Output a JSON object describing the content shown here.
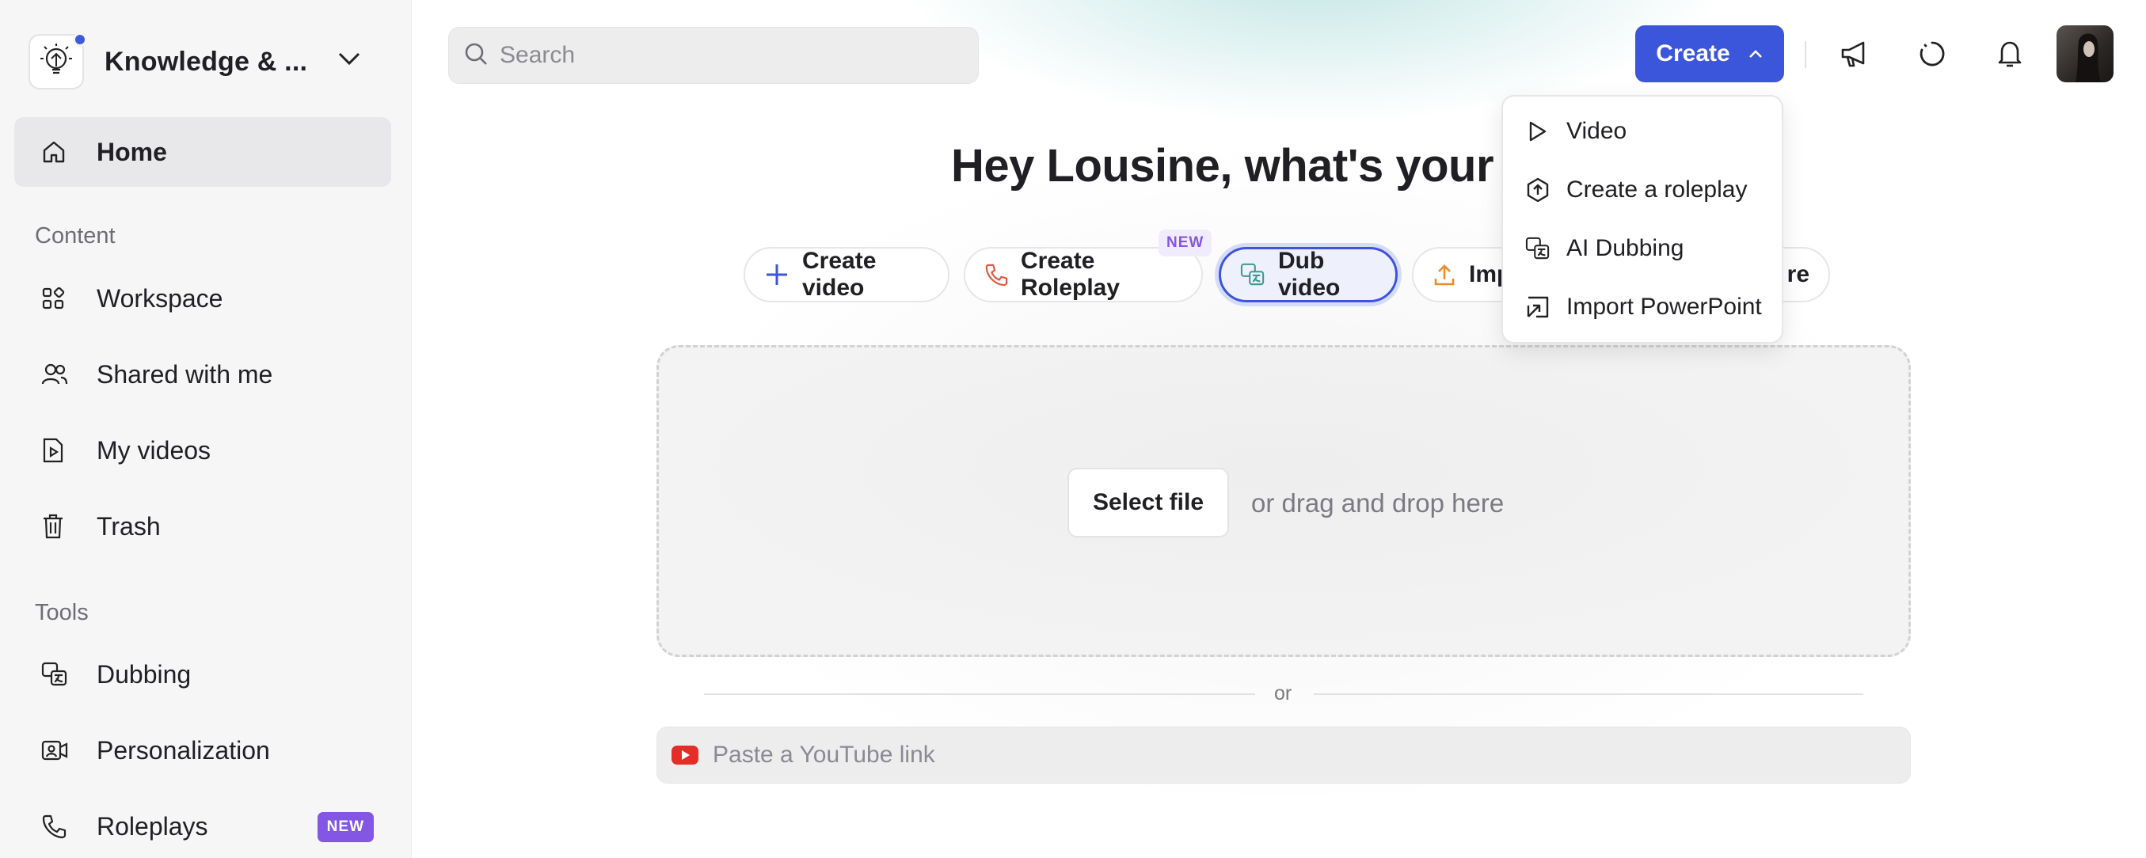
{
  "sidebar": {
    "workspace_name": "Knowledge & ...",
    "home_label": "Home",
    "content_section": "Content",
    "tools_section": "Tools",
    "content_items": [
      {
        "label": "Workspace",
        "icon": "grid-icon"
      },
      {
        "label": "Shared with me",
        "icon": "users-icon"
      },
      {
        "label": "My videos",
        "icon": "video-file-icon"
      },
      {
        "label": "Trash",
        "icon": "trash-icon"
      }
    ],
    "tool_items": [
      {
        "label": "Dubbing",
        "icon": "dubbing-icon"
      },
      {
        "label": "Personalization",
        "icon": "personalization-icon"
      },
      {
        "label": "Roleplays",
        "icon": "phone-icon",
        "badge": "NEW"
      }
    ]
  },
  "header": {
    "search_placeholder": "Search",
    "create_label": "Create",
    "icons": [
      "megaphone-icon",
      "loading-icon",
      "bell-icon"
    ]
  },
  "main": {
    "headline": "Hey Lousine, what's your next",
    "chips": [
      {
        "label": "Create video",
        "icon": "plus-icon"
      },
      {
        "label": "Create Roleplay",
        "icon": "phone-icon",
        "badge": "NEW"
      },
      {
        "label": "Dub video",
        "icon": "dubbing-icon",
        "selected": true
      },
      {
        "label": "Imp",
        "icon": "upload-icon"
      },
      {
        "label": "re",
        "icon": ""
      }
    ],
    "select_file_label": "Select file",
    "drop_text": "or drag and drop here",
    "or_label": "or",
    "youtube_placeholder": "Paste a YouTube link"
  },
  "dropdown": {
    "items": [
      {
        "label": "Video",
        "icon": "play-icon"
      },
      {
        "label": "Create a roleplay",
        "icon": "roleplay-icon"
      },
      {
        "label": "AI Dubbing",
        "icon": "dubbing-icon"
      },
      {
        "label": "Import PowerPoint",
        "icon": "import-icon"
      }
    ]
  },
  "colors": {
    "accent": "#3b55db",
    "badge": "#8356e3",
    "youtube": "#e52d27"
  }
}
